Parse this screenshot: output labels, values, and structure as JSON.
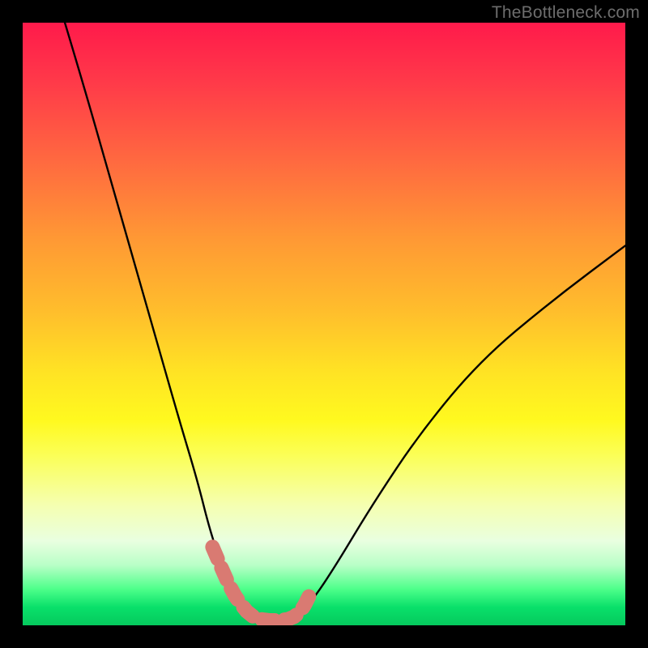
{
  "watermark": "TheBottleneck.com",
  "colors": {
    "frame": "#000000",
    "curve": "#000000",
    "marker": "#d97a72",
    "gradient_stops": [
      "#ff1a4b",
      "#ff3a49",
      "#ff6d3f",
      "#ff9934",
      "#ffbe2c",
      "#ffe324",
      "#fff91f",
      "#fbff59",
      "#f5ffb0",
      "#e9ffe0",
      "#b9ffc7",
      "#4dff8a",
      "#09e06a",
      "#05c95d"
    ]
  },
  "chart_data": {
    "type": "line",
    "title": "",
    "xlabel": "",
    "ylabel": "",
    "xlim": [
      0,
      100
    ],
    "ylim": [
      0,
      100
    ],
    "notes": "Qualitative V-shaped bottleneck curve. Axes are unlabeled; values are estimated positions in percent coordinates. Lower (green) is better, higher (red) is worse. Pink markers cluster near the valley.",
    "series": [
      {
        "name": "left-branch",
        "x": [
          7,
          10,
          14,
          18,
          22,
          26,
          29,
          31,
          33,
          34.5,
          36,
          37,
          38
        ],
        "y": [
          100,
          90,
          76,
          62,
          48,
          34,
          24,
          16,
          10,
          6,
          3,
          1.2,
          0.7
        ]
      },
      {
        "name": "valley-floor",
        "x": [
          38,
          40,
          42,
          44,
          45
        ],
        "y": [
          0.7,
          0.5,
          0.5,
          0.7,
          1.0
        ]
      },
      {
        "name": "right-branch",
        "x": [
          45,
          48,
          52,
          58,
          66,
          76,
          88,
          100
        ],
        "y": [
          1.0,
          4,
          10,
          20,
          32,
          44,
          54,
          63
        ]
      }
    ],
    "markers": {
      "name": "highlight-points",
      "x": [
        31.5,
        33,
        34.2,
        35.3,
        36.3,
        37.2,
        38.2,
        39.5,
        41,
        42.5,
        44,
        45,
        46,
        46.8,
        47.5
      ],
      "y": [
        13,
        9.5,
        6.8,
        4.8,
        3.4,
        2.3,
        1.5,
        1.0,
        0.8,
        0.8,
        1.0,
        1.4,
        2.2,
        3.4,
        4.8
      ]
    }
  }
}
